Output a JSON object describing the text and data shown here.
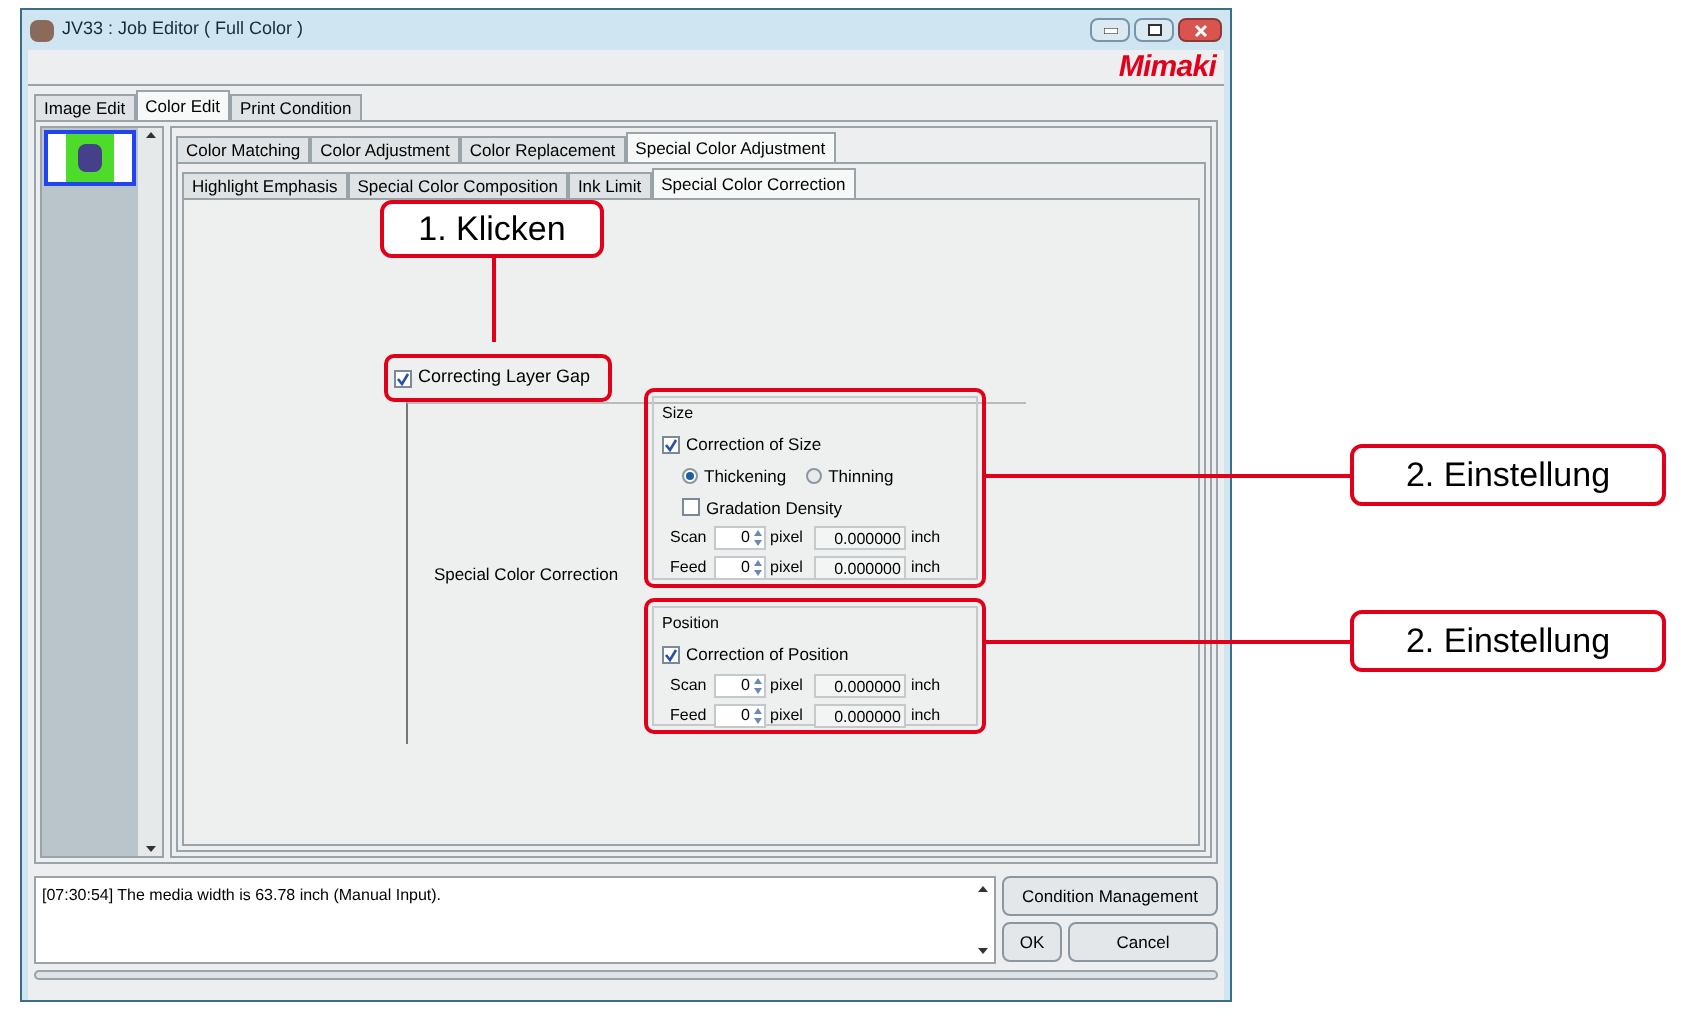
{
  "window": {
    "title": "JV33 : Job Editor ( Full Color )",
    "logo": "Mimaki"
  },
  "main_tabs": [
    {
      "label": "Image Edit",
      "selected": false
    },
    {
      "label": "Color Edit",
      "selected": true
    },
    {
      "label": "Print Condition",
      "selected": false
    }
  ],
  "sub_tabs": [
    {
      "label": "Color Matching",
      "selected": false
    },
    {
      "label": "Color Adjustment",
      "selected": false
    },
    {
      "label": "Color Replacement",
      "selected": false
    },
    {
      "label": "Special Color Adjustment",
      "selected": true
    }
  ],
  "inner_tabs": [
    {
      "label": "Highlight Emphasis",
      "selected": false
    },
    {
      "label": "Special Color Composition",
      "selected": false
    },
    {
      "label": "Ink Limit",
      "selected": false
    },
    {
      "label": "Special Color Correction",
      "selected": true
    }
  ],
  "correcting_layer_gap": {
    "label": "Correcting Layer Gap",
    "checked": true
  },
  "section_label": "Special Color Correction",
  "size_group": {
    "title": "Size",
    "correction": {
      "label": "Correction of Size",
      "checked": true
    },
    "options": [
      {
        "label": "Thickening",
        "selected": true
      },
      {
        "label": "Thinning",
        "selected": false
      }
    ],
    "gradation": {
      "label": "Gradation Density",
      "checked": false
    },
    "rows": [
      {
        "label": "Scan",
        "value": "0",
        "unit": "pixel",
        "inch_value": "0.000000",
        "inch_unit": "inch"
      },
      {
        "label": "Feed",
        "value": "0",
        "unit": "pixel",
        "inch_value": "0.000000",
        "inch_unit": "inch"
      }
    ]
  },
  "position_group": {
    "title": "Position",
    "correction": {
      "label": "Correction of Position",
      "checked": true
    },
    "rows": [
      {
        "label": "Scan",
        "value": "0",
        "unit": "pixel",
        "inch_value": "0.000000",
        "inch_unit": "inch"
      },
      {
        "label": "Feed",
        "value": "0",
        "unit": "pixel",
        "inch_value": "0.000000",
        "inch_unit": "inch"
      }
    ]
  },
  "log": {
    "text": "[07:30:54] The media width is 63.78 inch (Manual Input)."
  },
  "buttons": [
    "Condition Management",
    "OK",
    "Cancel"
  ],
  "callouts": [
    {
      "text": "1. Klicken"
    },
    {
      "text": "2. Einstellung"
    },
    {
      "text": "2. Einstellung"
    }
  ]
}
